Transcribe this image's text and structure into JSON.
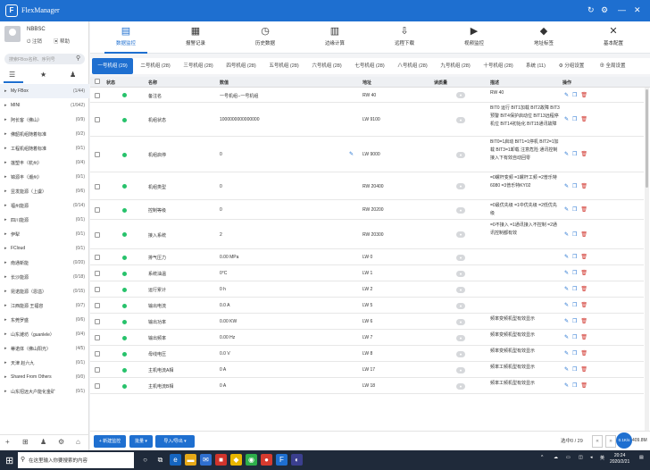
{
  "app": {
    "title": "FlexManager",
    "logo": "F"
  },
  "window_controls": {
    "refresh_icon": "↻",
    "settings_icon": "⚙",
    "minimize_icon": "—",
    "close_icon": "✕"
  },
  "user": {
    "name": "NBBSC",
    "logout": "注销",
    "help": "帮助"
  },
  "search": {
    "placeholder": "搜索FBox名称、序列号"
  },
  "sidebar_tabs": {
    "list_icon": "☰",
    "star_icon": "★",
    "user_icon": "♟"
  },
  "tree": [
    {
      "label": "My FBox",
      "count": "(1/44)"
    },
    {
      "label": "MINI",
      "count": "(1/942)"
    },
    {
      "label": "阿长客（佛山）",
      "count": "(0/9)"
    },
    {
      "label": "佛韶机组随着标准",
      "count": "(0/2)"
    },
    {
      "label": "工程机组随着标准",
      "count": "(0/1)"
    },
    {
      "label": "莲塑丰（杭州）",
      "count": "(0/4)"
    },
    {
      "label": "锦源丰（潮州）",
      "count": "(0/1)"
    },
    {
      "label": "昱发能源（上虞）",
      "count": "(0/6)"
    },
    {
      "label": "福州能源",
      "count": "(0/14)"
    },
    {
      "label": "四川能源",
      "count": "(0/1)"
    },
    {
      "label": "伊犁",
      "count": "(0/1)"
    },
    {
      "label": "FCloud",
      "count": "(0/1)"
    },
    {
      "label": "南通新能",
      "count": "(0/20)"
    },
    {
      "label": "长沙能源",
      "count": "(0/18)"
    },
    {
      "label": "昆诺能源（恩溢）",
      "count": "(0/15)"
    },
    {
      "label": "江西能源 王福容",
      "count": "(0/7)"
    },
    {
      "label": "东莞罗盛",
      "count": "(0/6)"
    },
    {
      "label": "山东潍坊（guanlele）",
      "count": "(0/4)"
    },
    {
      "label": "蒂诺体（佛山阳光）",
      "count": "(4/5)"
    },
    {
      "label": "天津 赵六九",
      "count": "(0/1)"
    },
    {
      "label": "Shared From Others",
      "count": "(0/0)"
    },
    {
      "label": "山东招远大户能化金矿",
      "count": "(0/1)"
    }
  ],
  "sidebar_footer": [
    "+",
    "⊞",
    "♟",
    "⚙",
    "⌂"
  ],
  "toolbar": [
    {
      "label": "数据监控",
      "icon": "▤"
    },
    {
      "label": "报警记录",
      "icon": "▦"
    },
    {
      "label": "历史数据",
      "icon": "◷"
    },
    {
      "label": "边缘计算",
      "icon": "▥"
    },
    {
      "label": "远程下载",
      "icon": "⇩"
    },
    {
      "label": "视频监控",
      "icon": "▶"
    },
    {
      "label": "地址标签",
      "icon": "◆"
    },
    {
      "label": "基本配置",
      "icon": "✕"
    }
  ],
  "tabs": [
    "一号机组 (29)",
    "二号机组 (28)",
    "三号机组 (28)",
    "四号机组 (28)",
    "五号机组 (28)",
    "六号机组 (28)",
    "七号机组 (28)",
    "八号机组 (28)",
    "九号机组 (28)",
    "十号机组 (28)",
    "系统 (11)",
    "⚙ 分组设置",
    "⊕ 全局设置"
  ],
  "table": {
    "headers": [
      "状态",
      "名称",
      "数值",
      "地址",
      "读质量",
      "描述",
      "操作"
    ],
    "rows": [
      {
        "name": "备注名",
        "value": "一号机组--一号机组",
        "addr": "RW 40",
        "desc": "RW 40",
        "edit": false
      },
      {
        "name": "机组状态",
        "value": "1000000000000000",
        "addr": "LW 9100",
        "desc": "BIT0 运行 BIT1加载 BIT2故障 BIT3预警 BIT4保护启动位 BIT13远程停机位 BIT14初始化 BIT15通讯故障",
        "edit": false
      },
      {
        "name": "机组启停",
        "value": "0",
        "addr": "LW 9000",
        "desc": "BIT0=1启动 BIT1=1停机 BIT2=1加载 BIT3=1卸载 注意危险 通讯控制接入下有效自动回零",
        "edit": true
      },
      {
        "name": "机组类型",
        "value": "0",
        "addr": "RW 20400",
        "desc": "=0螺杆变频 =1螺杆工频 =2普乐特6080 =3普乐特KY02",
        "edit": false
      },
      {
        "name": "控制等级",
        "value": "0",
        "addr": "RW 20200",
        "desc": "=0最优先级 =1中优先级 =2低优先级",
        "edit": false
      },
      {
        "name": "接入系统",
        "value": "2",
        "addr": "RW 20300",
        "desc": "=0不接入 =1通讯接入不控制 =2通讯控制都有效",
        "edit": false
      },
      {
        "name": "排气压力",
        "value": "0.00 MPa",
        "addr": "LW 0",
        "desc": "",
        "edit": false
      },
      {
        "name": "系统油温",
        "value": "0°C",
        "addr": "LW 1",
        "desc": "",
        "edit": false
      },
      {
        "name": "运行累计",
        "value": "0 h",
        "addr": "LW 2",
        "desc": "",
        "edit": false
      },
      {
        "name": "输出电流",
        "value": "0.0 A",
        "addr": "LW 5",
        "desc": "",
        "edit": false
      },
      {
        "name": "输出功率",
        "value": "0.00 KW",
        "addr": "LW 6",
        "desc": "频率变频机型有效显示",
        "edit": false
      },
      {
        "name": "输出频率",
        "value": "0.00 Hz",
        "addr": "LW 7",
        "desc": "频率变频机型有效显示",
        "edit": false
      },
      {
        "name": "母线电压",
        "value": "0.0 V",
        "addr": "LW 8",
        "desc": "频率变频机型有效显示",
        "edit": false
      },
      {
        "name": "主机电流A相",
        "value": "0 A",
        "addr": "LW 17",
        "desc": "频率工频机型有效显示",
        "edit": false
      },
      {
        "name": "主机电流B相",
        "value": "0 A",
        "addr": "LW 18",
        "desc": "频率工频机型有效显示",
        "edit": false
      }
    ]
  },
  "bottom": {
    "add": "+ 新建监控",
    "batch": "批量 ▾",
    "io": "导入/导出 ▾",
    "paging": "选中0 / 29",
    "prev": "«",
    "next": "»",
    "speed": "0.1K/s",
    "speed_value": "409.8M"
  },
  "taskbar": {
    "search": "在这里输入你要搜索的内容",
    "time": "20:24",
    "date": "2020/2/21",
    "lang": "英"
  },
  "colors": {
    "brand": "#1e6fd0",
    "status_ok": "#27c26b",
    "delete": "#d0342c"
  }
}
